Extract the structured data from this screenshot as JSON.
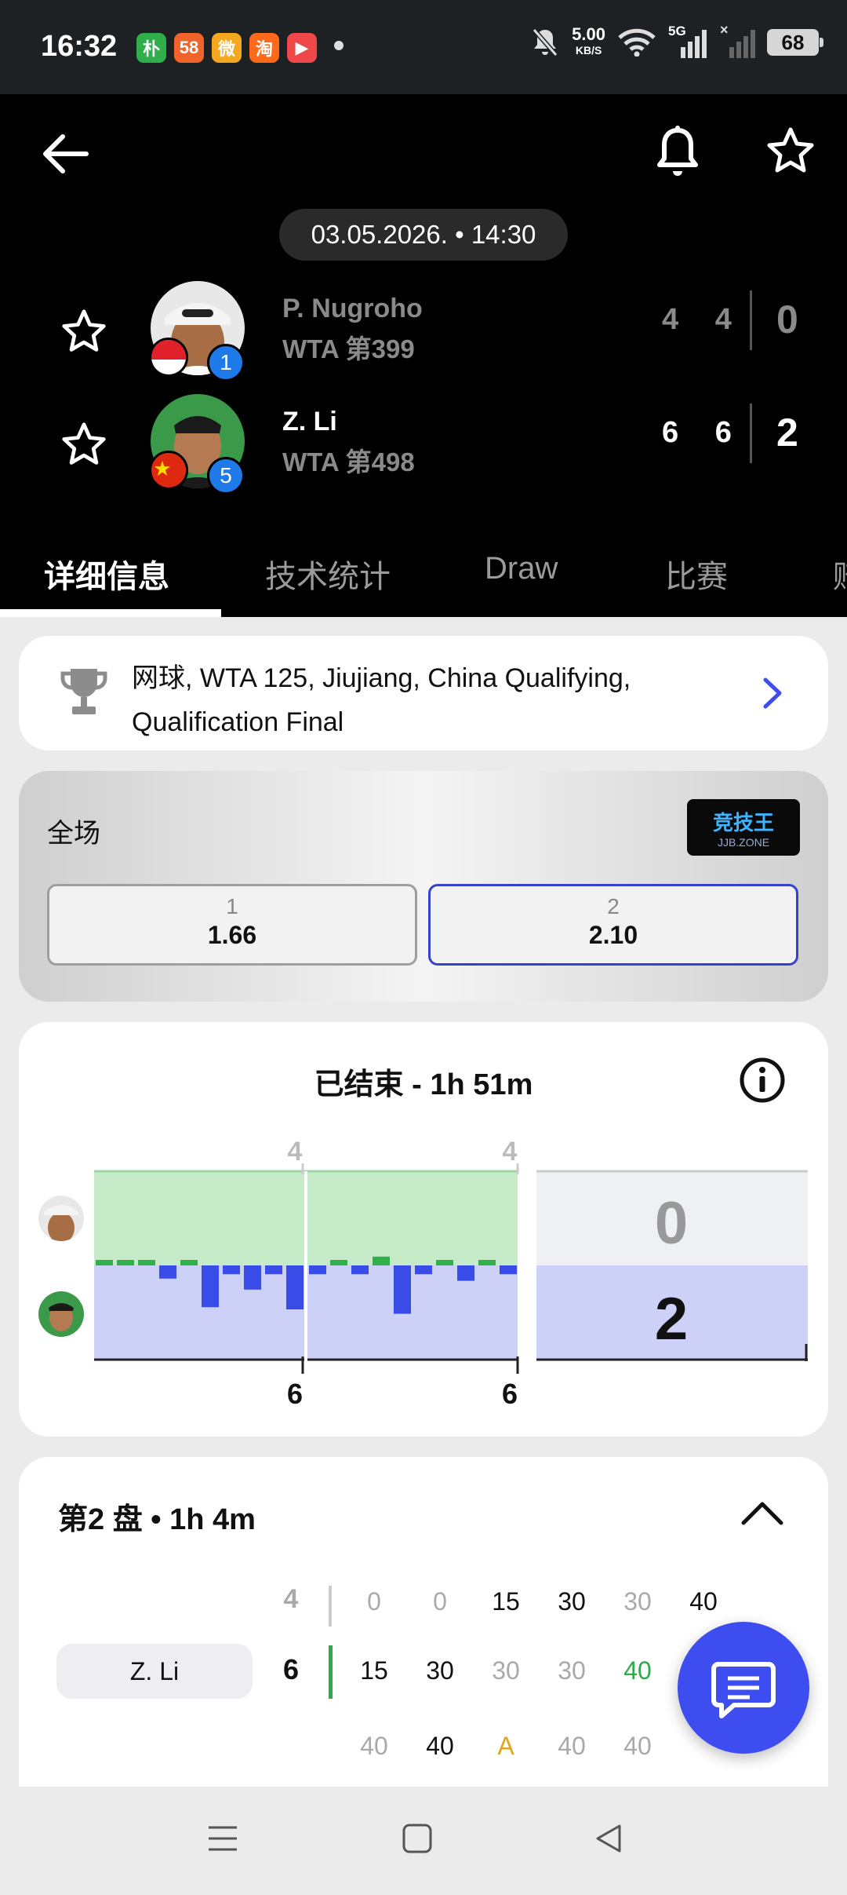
{
  "status_bar": {
    "time": "16:32",
    "apps": [
      {
        "glyph": "朴",
        "color": "#2fae4a"
      },
      {
        "glyph": "58",
        "color": "#f0642c"
      },
      {
        "glyph": "微",
        "color": "#f3a81f"
      },
      {
        "glyph": "淘",
        "color": "#ff6a1a"
      },
      {
        "glyph": "▶",
        "color": "#f04848"
      }
    ],
    "speed_value": "5.00",
    "speed_unit": "KB/S",
    "network": "5G",
    "battery": "68"
  },
  "header": {
    "datetime": "03.05.2026. • 14:30",
    "players": [
      {
        "name": "P. Nugroho",
        "rank": "WTA 第399",
        "seed": "1",
        "games": "4 4",
        "sets": "0",
        "flag": "indonesia"
      },
      {
        "name": "Z. Li",
        "rank": "WTA 第498",
        "seed": "5",
        "games": "6 6",
        "sets": "2",
        "flag": "china"
      }
    ],
    "tabs": [
      "详细信息",
      "技术统计",
      "Draw",
      "比赛",
      "赔"
    ]
  },
  "league": {
    "text": "网球, WTA 125, Jiujiang, China Qualifying, Qualification Final"
  },
  "odds": {
    "title": "全场",
    "brand_main": "竞技王",
    "brand_sub": "JJB.ZONE",
    "options": [
      {
        "label": "1",
        "value": "1.66",
        "selected": false
      },
      {
        "label": "2",
        "value": "2.10",
        "selected": true
      }
    ]
  },
  "momentum": {
    "title": "已结束 - 1h 51m",
    "set_top": [
      "4",
      "4"
    ],
    "set_bottom": [
      "6",
      "6"
    ],
    "score_top": "0",
    "score_bottom": "2",
    "set1_bars": [
      0.5,
      0.5,
      0.5,
      -1.2,
      0.5,
      -3.8,
      -0.8,
      -2.2,
      -0.8,
      -4.0
    ],
    "set2_bars": [
      -0.8,
      0.5,
      -0.8,
      0.8,
      -4.4,
      -0.8,
      0.5,
      -1.4,
      0.5,
      -0.8
    ]
  },
  "set2": {
    "title": "第2 盘 • 1h 4m",
    "player": "Z. Li",
    "rows": [
      {
        "game": "4",
        "points": [
          "0",
          "0",
          "15",
          "30",
          "30",
          "40"
        ]
      },
      {
        "game": "6",
        "points": [
          "15",
          "30",
          "30",
          "30",
          "40"
        ]
      },
      {
        "game": "",
        "points": [
          "40",
          "40",
          "A",
          "40",
          "40"
        ]
      }
    ]
  }
}
